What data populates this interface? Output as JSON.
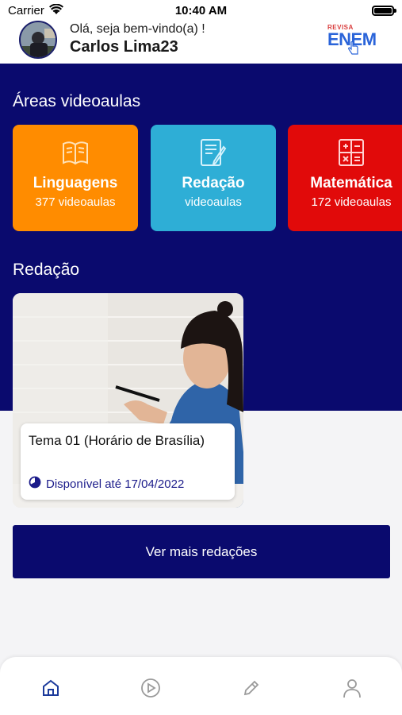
{
  "status_bar": {
    "carrier": "Carrier",
    "time": "10:40 AM",
    "battery_level": 0.9
  },
  "header": {
    "greeting": "Olá, seja bem-vindo(a) !",
    "username": "Carlos Lima23",
    "logo_small": "REVISA",
    "logo_big": "ENEM"
  },
  "areas": {
    "title": "Áreas videoaulas",
    "cards": [
      {
        "title": "Linguagens",
        "count": "377 videoaulas",
        "color": "#ff8c00",
        "icon": "book-icon"
      },
      {
        "title": "Redação",
        "count": "videoaulas",
        "color": "#2eaed6",
        "icon": "document-edit-icon"
      },
      {
        "title": "Matemática",
        "count": "172 videoaulas",
        "color": "#e10a0a",
        "icon": "calculator-icon"
      }
    ]
  },
  "redacao": {
    "title": "Redação",
    "essay": {
      "title": "Tema 01 (Horário de Brasília)",
      "availability": "Disponível até 17/04/2022"
    },
    "more_button": "Ver mais redações"
  },
  "tabbar": {
    "tabs": [
      {
        "icon": "home-icon",
        "active": true
      },
      {
        "icon": "play-icon",
        "active": false
      },
      {
        "icon": "pencil-icon",
        "active": false
      },
      {
        "icon": "user-icon",
        "active": false
      }
    ]
  },
  "colors": {
    "navy": "#0a0a6e",
    "active_tab": "#1b3a9b",
    "inactive_tab": "#9a9a9a"
  }
}
